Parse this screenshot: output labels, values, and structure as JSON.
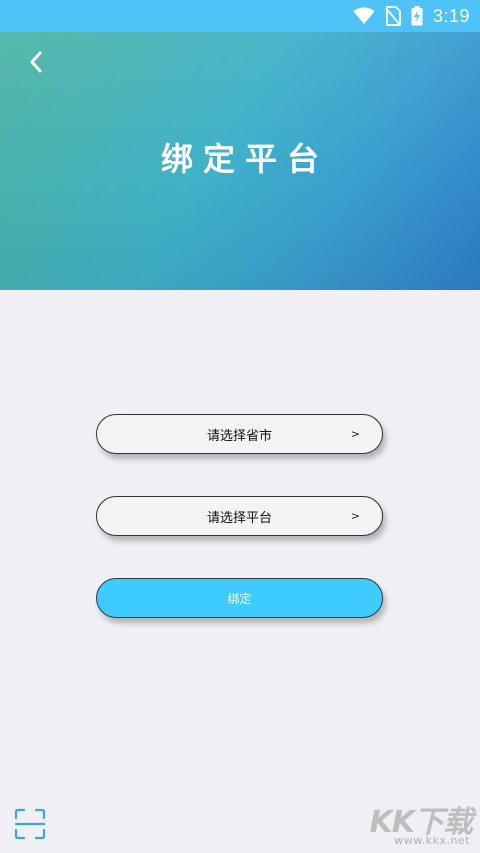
{
  "status_bar": {
    "time": "3:19",
    "icons": [
      "wifi-icon",
      "no-sim-icon",
      "battery-charging-icon"
    ],
    "background": "#4fc3f7"
  },
  "header": {
    "title": "绑定平台",
    "back_icon": "chevron-left-icon",
    "gradient_colors": [
      "#4bb4a5",
      "#3fb2c8",
      "#2f7fc9"
    ]
  },
  "form": {
    "province_select": {
      "label": "请选择省市",
      "chevron": ">"
    },
    "platform_select": {
      "label": "请选择平台",
      "chevron": ">"
    },
    "bind_button": {
      "label": "绑定",
      "color": "#3ecbff"
    }
  },
  "footer": {
    "scan_icon": "scan-icon"
  },
  "watermark": {
    "main": "KK下载",
    "url": "www.kkx.net"
  }
}
